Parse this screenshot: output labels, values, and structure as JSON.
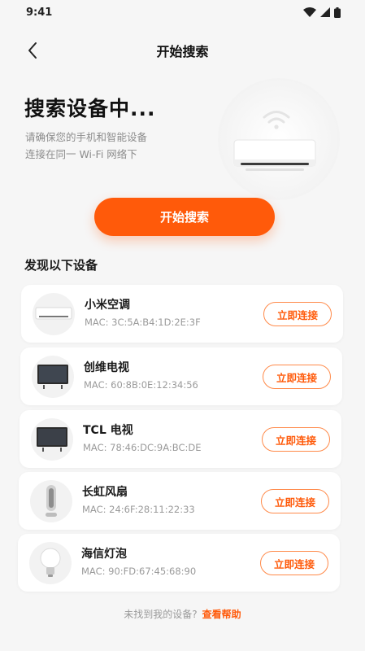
{
  "status_bar": {
    "time": "9:41"
  },
  "nav": {
    "title": "开始搜索"
  },
  "hero": {
    "title": "搜索设备中...",
    "desc_line1": "请确保您的手机和智能设备",
    "desc_line2": "连接在同一 Wi-Fi 网络下"
  },
  "primary_button": {
    "label": "开始搜索"
  },
  "section": {
    "title": "发现以下设备"
  },
  "devices": [
    {
      "name": "小米空调",
      "mac": "MAC: 3C:5A:B4:1D:2E:3F",
      "action": "立即连接",
      "icon": "air-conditioner-icon"
    },
    {
      "name": "创维电视",
      "mac": "MAC: 60:8B:0E:12:34:56",
      "action": "立即连接",
      "icon": "tv-icon"
    },
    {
      "name": "TCL 电视",
      "mac": "MAC: 78:46:DC:9A:BC:DE",
      "action": "立即连接",
      "icon": "tv-icon"
    },
    {
      "name": "长虹风扇",
      "mac": "MAC: 24:6F:28:11:22:33",
      "action": "立即连接",
      "icon": "tower-fan-icon"
    },
    {
      "name": "海信灯泡",
      "mac": "MAC: 90:FD:67:45:68:90",
      "action": "立即连接",
      "icon": "light-bulb-icon"
    }
  ],
  "footer": {
    "text": "未找到我的设备?",
    "link": "查看帮助"
  },
  "colors": {
    "accent": "#ff5a0a",
    "background": "#f6f6f6",
    "card": "#ffffff"
  }
}
